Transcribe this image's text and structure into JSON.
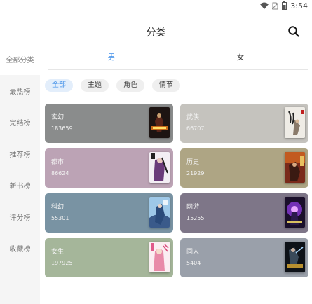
{
  "status_bar": {
    "time": "3:54"
  },
  "header": {
    "title": "分类"
  },
  "sidebar": {
    "items": [
      {
        "label": "全部分类"
      },
      {
        "label": "最热榜"
      },
      {
        "label": "完结榜"
      },
      {
        "label": "推荐榜"
      },
      {
        "label": "新书榜"
      },
      {
        "label": "评分榜"
      },
      {
        "label": "收藏榜"
      }
    ]
  },
  "gender_tabs": [
    {
      "label": "男"
    },
    {
      "label": "女"
    }
  ],
  "filters": [
    {
      "label": "全部"
    },
    {
      "label": "主题"
    },
    {
      "label": "角色"
    },
    {
      "label": "情节"
    }
  ],
  "categories": [
    {
      "name": "玄幻",
      "count": "183659",
      "color": "#8a8c8c",
      "cover": "cover-dark-red"
    },
    {
      "name": "武侠",
      "count": "66707",
      "color": "#c5c3be",
      "cover": "cover-light-ink"
    },
    {
      "name": "都市",
      "count": "86624",
      "color": "#bca3b5",
      "cover": "cover-pink-figure"
    },
    {
      "name": "历史",
      "count": "21929",
      "color": "#aea584",
      "cover": "cover-orange-red"
    },
    {
      "name": "科幻",
      "count": "55301",
      "color": "#7993a3",
      "cover": "cover-blue-figure"
    },
    {
      "name": "网游",
      "count": "15255",
      "color": "#7e7688",
      "cover": "cover-purple-glow"
    },
    {
      "name": "女生",
      "count": "197925",
      "color": "#a5b69a",
      "cover": "cover-pink-girl"
    },
    {
      "name": "同人",
      "count": "5404",
      "color": "#9aa0aa",
      "cover": "cover-dark-battle"
    }
  ],
  "colors": {
    "accent": "#3d8ee8"
  }
}
